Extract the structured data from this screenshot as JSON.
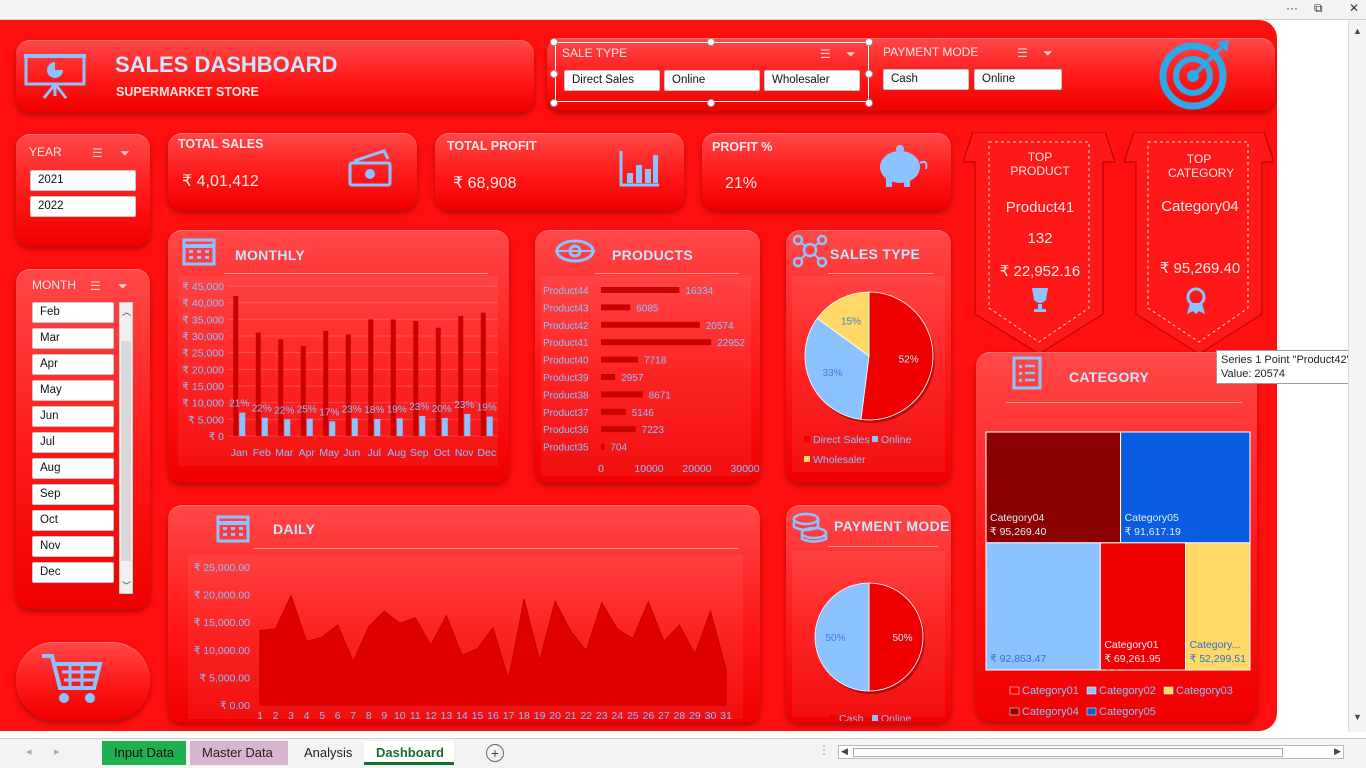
{
  "window": {
    "ctrl_dots": "···",
    "ctrl_restore": "⧉",
    "ctrl_close": "✕"
  },
  "header": {
    "title": "SALES DASHBOARD",
    "subtitle": "SUPERMARKET STORE"
  },
  "sale_type_slicer": {
    "title": "SALE TYPE",
    "items": [
      "Direct Sales",
      "Online",
      "Wholesaler"
    ]
  },
  "payment_slicer": {
    "title": "PAYMENT MODE",
    "items": [
      "Cash",
      "Online"
    ]
  },
  "year_slicer": {
    "title": "YEAR",
    "items": [
      "2021",
      "2022"
    ]
  },
  "month_slicer": {
    "title": "MONTH",
    "items": [
      "Feb",
      "Mar",
      "Apr",
      "May",
      "Jun",
      "Jul",
      "Aug",
      "Sep",
      "Oct",
      "Nov",
      "Dec"
    ]
  },
  "kpis": {
    "total_sales": {
      "label": "TOTAL SALES",
      "value": "₹ 4,01,412"
    },
    "total_profit": {
      "label": "TOTAL  PROFIT",
      "value": "₹ 68,908"
    },
    "profit_pct": {
      "label": "PROFIT %",
      "value": "21%"
    }
  },
  "top_product": {
    "label": "TOP PRODUCT",
    "name": "Product41",
    "qty": "132",
    "amount": "₹ 22,952.16"
  },
  "top_category": {
    "label": "TOP CATEGORY",
    "name": "Category04",
    "amount": "₹ 95,269.40"
  },
  "panels": {
    "monthly": "MONTHLY",
    "products": "PRODUCTS",
    "sales_type": "SALES TYPE",
    "daily": "DAILY",
    "payment_mode": "PAYMENT MODE",
    "category": "CATEGORY"
  },
  "colors": {
    "bg": "#ff1010",
    "accent_blue": "#8cc2ff",
    "dark_red": "#8b0000",
    "yellow": "#ffd866",
    "blue": "#0a5ce0"
  },
  "chart_data": [
    {
      "id": "monthly",
      "type": "bar",
      "categories": [
        "Jan",
        "Feb",
        "Mar",
        "Apr",
        "May",
        "Jun",
        "Jul",
        "Aug",
        "Sep",
        "Oct",
        "Nov",
        "Dec"
      ],
      "series": [
        {
          "values": [
            42000,
            31000,
            29000,
            27000,
            31500,
            30500,
            35000,
            35000,
            34500,
            32500,
            36000,
            37000
          ]
        },
        {
          "values": [
            7000,
            5500,
            5000,
            5200,
            4400,
            5300,
            5100,
            5300,
            6000,
            5400,
            6600,
            5800
          ]
        }
      ],
      "data_labels": [
        "21%",
        "22%",
        "22%",
        "25%",
        "17%",
        "23%",
        "18%",
        "19%",
        "23%",
        "20%",
        "23%",
        "19%"
      ],
      "ylim": [
        0,
        45000
      ],
      "yticks": [
        "₹ 0",
        "₹ 5,000",
        "₹ 10,000",
        "₹ 15,000",
        "₹ 20,000",
        "₹ 25,000",
        "₹ 30,000",
        "₹ 35,000",
        "₹ 40,000",
        "₹ 45,000"
      ]
    },
    {
      "id": "products",
      "type": "bar",
      "orientation": "horizontal",
      "categories": [
        "Product44",
        "Product43",
        "Product42",
        "Product41",
        "Product40",
        "Product39",
        "Product38",
        "Product37",
        "Product36",
        "Product35"
      ],
      "values": [
        16334,
        6085,
        20574,
        22952,
        7718,
        2957,
        8671,
        5146,
        7223,
        704
      ],
      "xlim": [
        0,
        30000
      ],
      "xticks": [
        "0",
        "10000",
        "20000",
        "30000"
      ]
    },
    {
      "id": "sales_type",
      "type": "pie",
      "categories": [
        "Direct Sales",
        "Online",
        "Wholesaler"
      ],
      "values": [
        52,
        33,
        15
      ],
      "data_labels": [
        "52%",
        "33%",
        "15%"
      ]
    },
    {
      "id": "daily",
      "type": "area",
      "x": [
        "1",
        "2",
        "3",
        "4",
        "5",
        "6",
        "7",
        "8",
        "9",
        "10",
        "11",
        "12",
        "13",
        "14",
        "15",
        "16",
        "17",
        "18",
        "19",
        "20",
        "21",
        "22",
        "23",
        "24",
        "25",
        "26",
        "27",
        "28",
        "29",
        "30",
        "31"
      ],
      "values": [
        13500,
        13800,
        19800,
        11500,
        12300,
        14500,
        7800,
        14200,
        17000,
        14800,
        15800,
        10800,
        16200,
        9000,
        10200,
        14000,
        4600,
        19200,
        8000,
        18800,
        13400,
        9800,
        18500,
        13800,
        12000,
        18700,
        11500,
        14500,
        9200,
        17000,
        6500
      ],
      "ylim": [
        0,
        25000
      ],
      "yticks": [
        "₹ 0.00",
        "₹ 5,000.00",
        "₹ 10,000.00",
        "₹ 15,000.00",
        "₹ 20,000.00",
        "₹ 25,000.00"
      ]
    },
    {
      "id": "payment_mode",
      "type": "pie",
      "categories": [
        "Cash",
        "Online"
      ],
      "values": [
        50,
        50
      ],
      "data_labels": [
        "50%",
        "50%"
      ]
    },
    {
      "id": "category",
      "type": "treemap",
      "categories": [
        "Category04",
        "Category05",
        "Category02",
        "Category01",
        "Category03"
      ],
      "values": [
        95269.4,
        91617.19,
        92853.47,
        69261.95,
        52299.51
      ],
      "data_labels": [
        "₹ 95,269.40",
        "₹ 91,617.19",
        "₹ 92,853.47",
        "₹ 69,261.95",
        "₹ 52,299.51"
      ],
      "short_labels": [
        "Category04",
        "Category05",
        "",
        "Category01",
        "Category..."
      ],
      "legend": [
        "Category01",
        "Category02",
        "Category03",
        "Category04",
        "Category05"
      ]
    }
  ],
  "tooltip": {
    "line1": "Series 1 Point \"Product42\"",
    "line2": "Value: 20574"
  },
  "sheets": {
    "tabs": [
      "Input Data",
      "Master Data",
      "Analysis",
      "Dashboard"
    ],
    "add": "+"
  }
}
